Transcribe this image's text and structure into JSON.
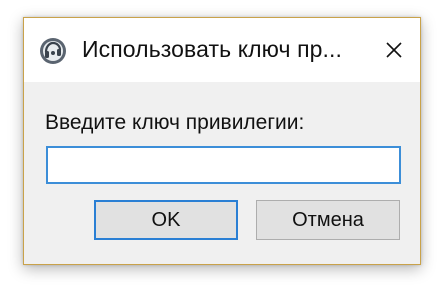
{
  "dialog": {
    "title": "Использовать ключ пр...",
    "app_icon": "app-logo-icon",
    "close_icon": "close-icon",
    "prompt_label": "Введите ключ привилегии:",
    "input": {
      "value": "",
      "placeholder": ""
    },
    "buttons": {
      "ok_label": "OK",
      "cancel_label": "Отмена"
    }
  },
  "colors": {
    "accent_blue": "#2a7fd4",
    "window_border": "#c9a24a",
    "window_bg": "#f0f0f0",
    "button_bg": "#e1e1e1"
  }
}
